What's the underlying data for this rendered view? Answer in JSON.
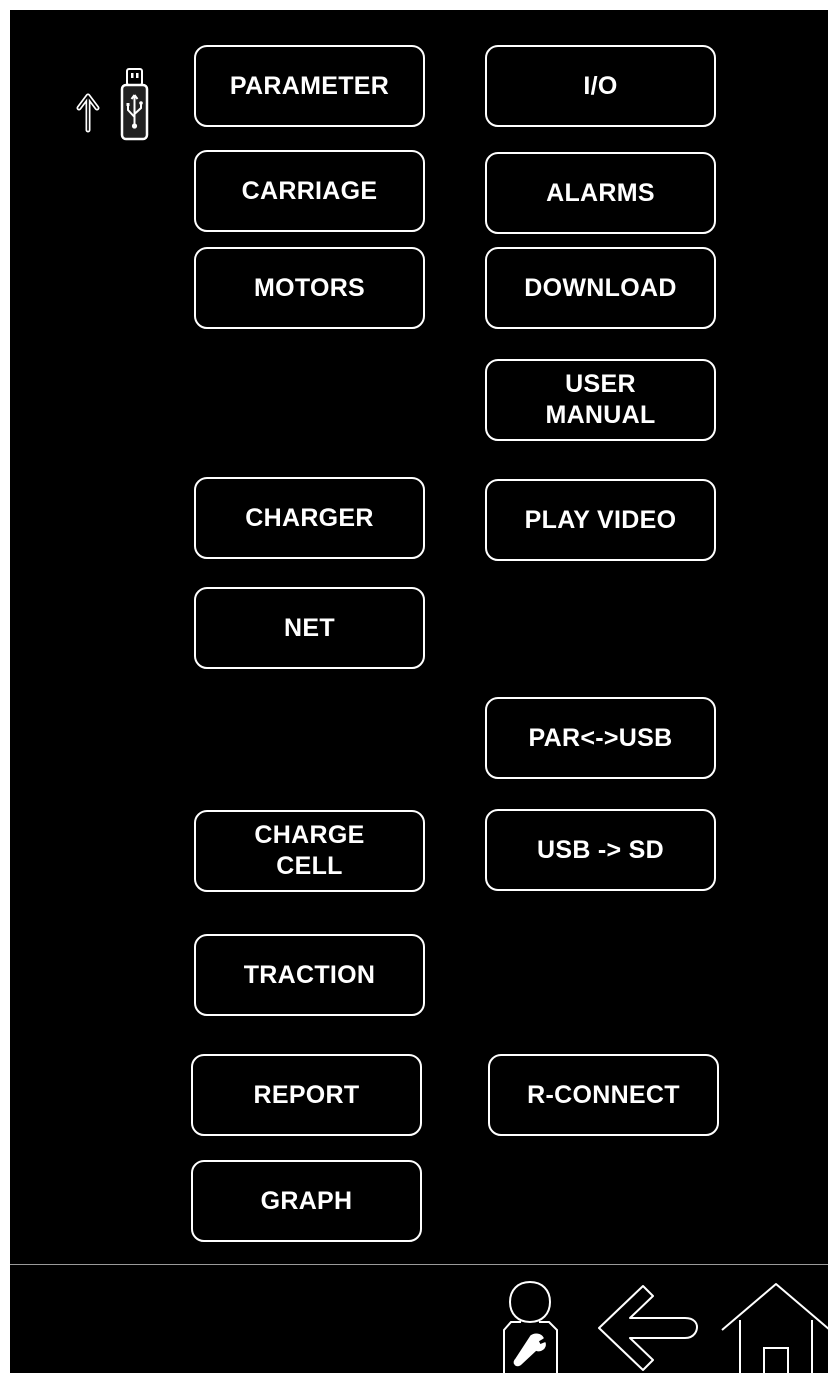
{
  "menu": {
    "parameter": "PARAMETER",
    "io": "I/O",
    "carriage": "CARRIAGE",
    "alarms": "ALARMS",
    "motors": "MOTORS",
    "download": "DOWNLOAD",
    "user_manual": "USER\nMANUAL",
    "charger": "CHARGER",
    "play_video": "PLAY VIDEO",
    "net": "NET",
    "par_usb": "PAR<->USB",
    "charge_cell": "CHARGE\nCELL",
    "usb_sd": "USB -> SD",
    "traction": "TRACTION",
    "report": "REPORT",
    "r_connect": "R-CONNECT",
    "graph": "GRAPH"
  },
  "status": {
    "usb_icon": "usb-upload-icon"
  },
  "nav": {
    "service_icon": "service-technician-icon",
    "back_icon": "back-arrow-icon",
    "home_icon": "home-icon"
  },
  "colors": {
    "background": "#000000",
    "foreground": "#ffffff",
    "divider": "#9a9a9a"
  }
}
